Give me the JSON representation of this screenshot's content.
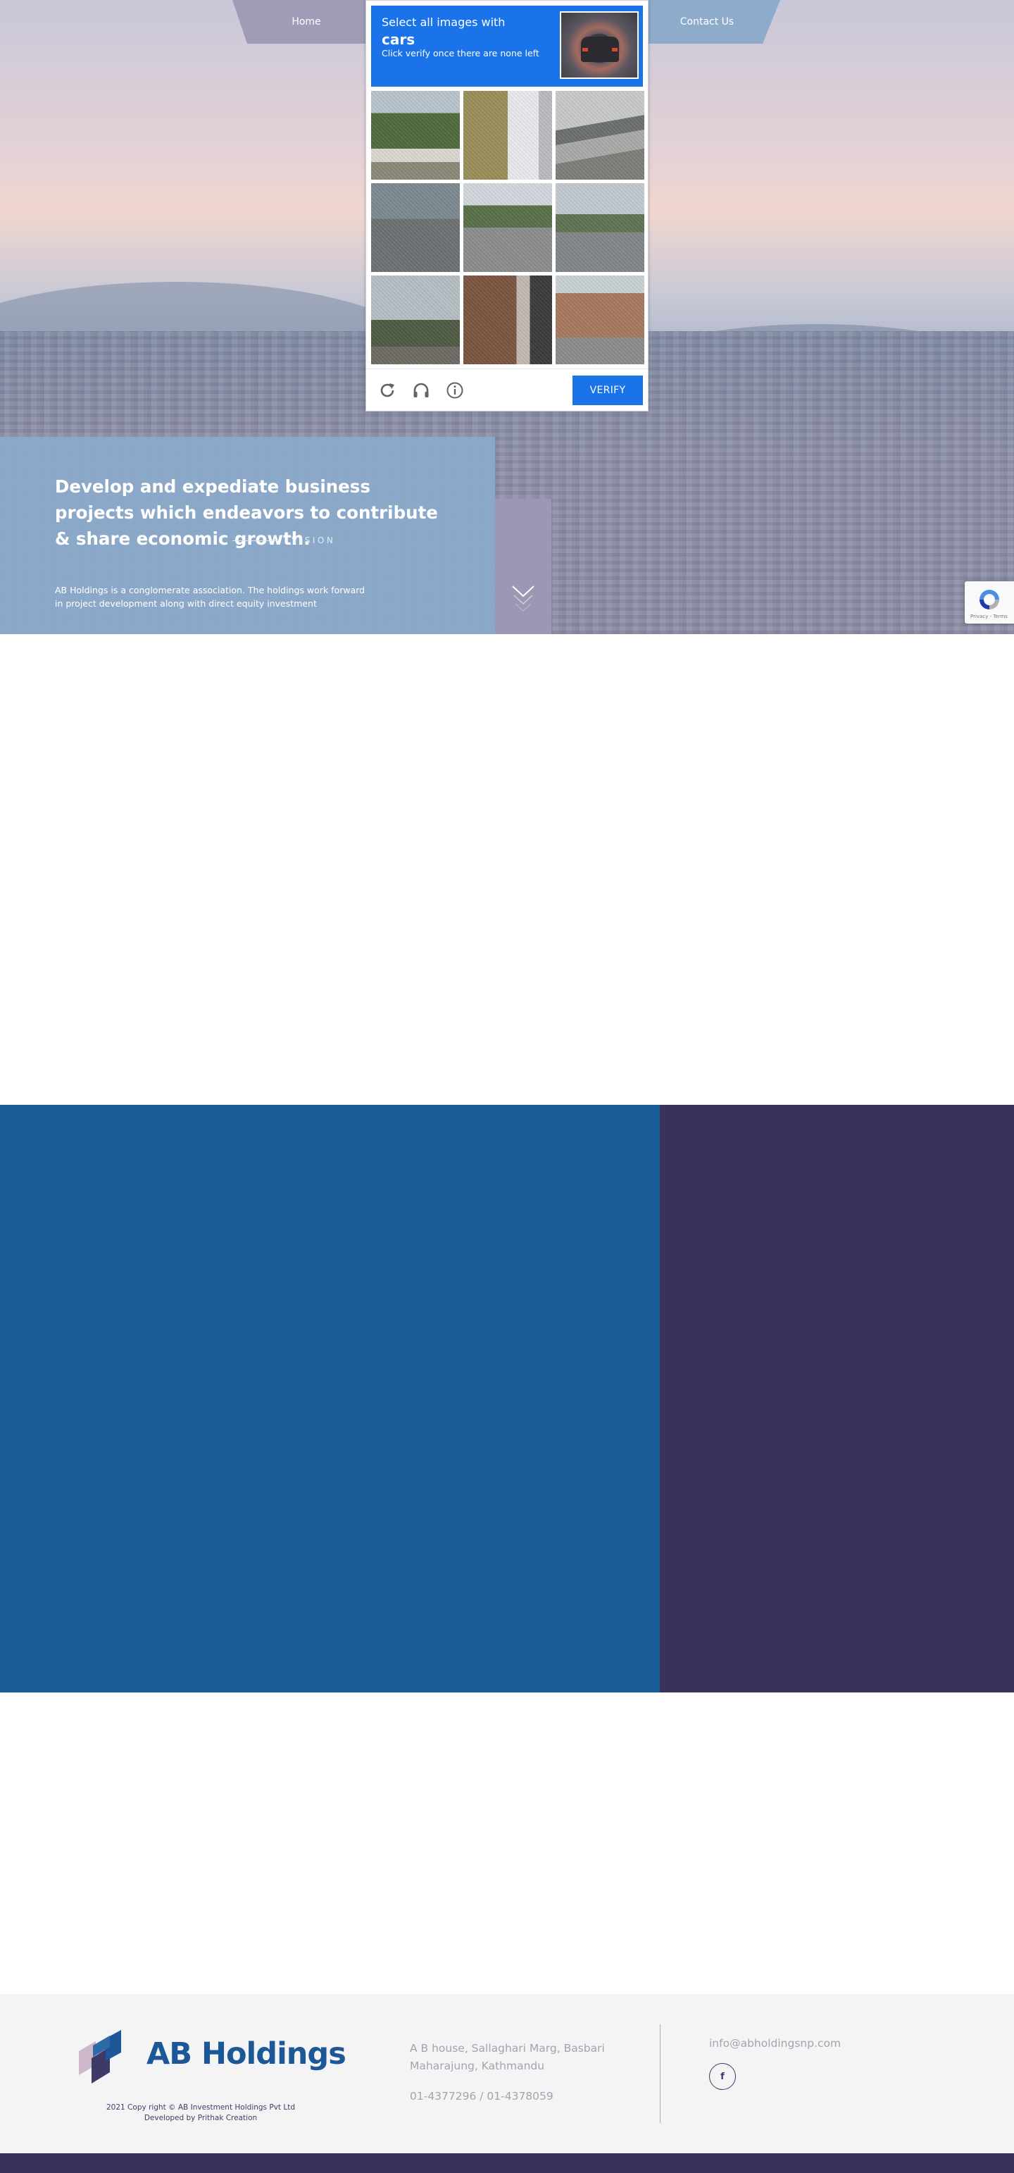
{
  "nav": {
    "home_label": "Home",
    "contact_label": "Contact Us"
  },
  "captcha": {
    "prompt_prefix": "Select all images with",
    "target": "cars",
    "instruction": "Click verify once there are none left",
    "verify_label": "VERIFY",
    "icons": [
      "reload-icon",
      "audio-headphones-icon",
      "info-icon"
    ],
    "tiles": [
      "trees and parked vehicles",
      "palm tree and building",
      "bridge underpass",
      "person on road",
      "tree-lined road",
      "street with pole",
      "trees and building",
      "traffic light",
      "apartment building"
    ],
    "colors": {
      "header": "#1a73e8",
      "button": "#1a73e8"
    }
  },
  "hero": {
    "heading": "Develop and expediate business projects which endeavors to contribute & share economic growth.",
    "section_label": "VISION",
    "description": "AB Holdings is a conglomerate association. The holdings work forward in project development along with direct equity investment",
    "colors": {
      "panel": "#8caacb",
      "scroll_block": "#9b97b4"
    }
  },
  "recaptcha_badge": {
    "links": "Privacy - Terms"
  },
  "blocks": {
    "blue": "#175c97",
    "purple": "#37335d"
  },
  "footer": {
    "logo_text": "AB Holdings",
    "copyright_line1": "2021 Copy right © AB Investment Holdings Pvt Ltd",
    "copyright_line2": "Developed by Prithak Creation",
    "address": "A B house, Sallaghari Marg, Basbari Maharajung, Kathmandu",
    "phone": "01-4377296 / 01-4378059",
    "email": "info@abholdingsnp.com",
    "social_icon": "f",
    "colors": {
      "brand": "#1c5897",
      "accent_purple": "#37335d"
    }
  }
}
